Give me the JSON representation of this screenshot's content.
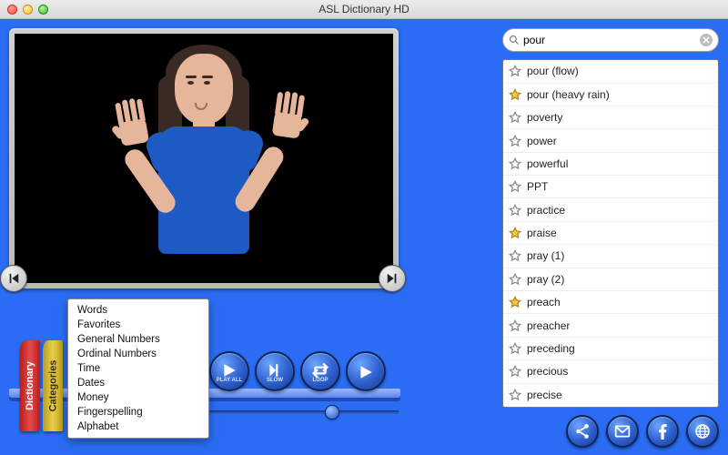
{
  "window": {
    "title": "ASL Dictionary HD"
  },
  "search": {
    "value": "pour"
  },
  "categories_popup": [
    "Words",
    "Favorites",
    "General Numbers",
    "Ordinal Numbers",
    "Time",
    "Dates",
    "Money",
    "Fingerspelling",
    "Alphabet"
  ],
  "books": {
    "dictionary": "Dictionary",
    "categories": "Categories"
  },
  "playback": {
    "play_all": "PLAY ALL",
    "slow": "SLOW",
    "loop": "LOOP",
    "play": "PLAY"
  },
  "wordlist": [
    {
      "label": "pour (flow)",
      "fav": false
    },
    {
      "label": "pour (heavy rain)",
      "fav": true
    },
    {
      "label": "poverty",
      "fav": false
    },
    {
      "label": "power",
      "fav": false
    },
    {
      "label": "powerful",
      "fav": false
    },
    {
      "label": "PPT",
      "fav": false
    },
    {
      "label": "practice",
      "fav": false
    },
    {
      "label": "praise",
      "fav": true
    },
    {
      "label": "pray (1)",
      "fav": false
    },
    {
      "label": "pray (2)",
      "fav": false
    },
    {
      "label": "preach",
      "fav": true
    },
    {
      "label": "preacher",
      "fav": false
    },
    {
      "label": "preceding",
      "fav": false
    },
    {
      "label": "precious",
      "fav": false
    },
    {
      "label": "precise",
      "fav": false
    }
  ],
  "icons": {
    "share": "share-icon",
    "mail": "mail-icon",
    "facebook": "facebook-icon",
    "web": "globe-icon"
  }
}
